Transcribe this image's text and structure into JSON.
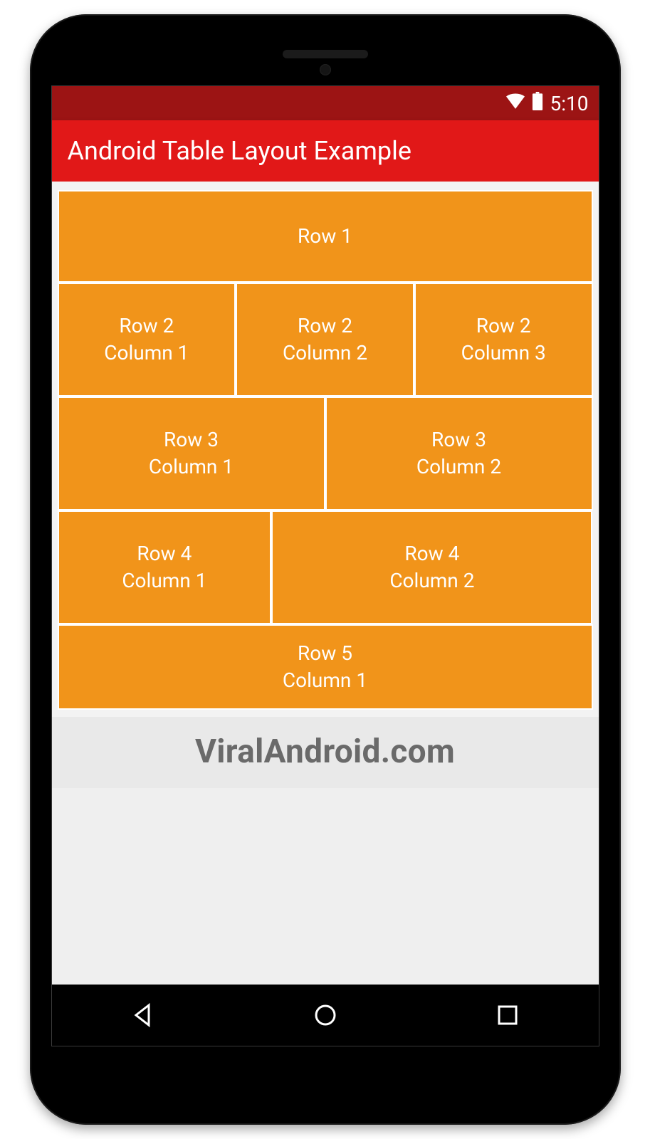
{
  "status": {
    "time": "5:10"
  },
  "appbar": {
    "title": "Android Table Layout Example"
  },
  "table": {
    "row1": {
      "c1": "Row 1"
    },
    "row2": {
      "c1": "Row 2\nColumn 1",
      "c2": "Row 2\nColumn 2",
      "c3": "Row 2\nColumn 3"
    },
    "row3": {
      "c1": "Row 3\nColumn 1",
      "c2": "Row 3\nColumn 2"
    },
    "row4": {
      "c1": "Row 4\nColumn 1",
      "c2": "Row 4\nColumn 2"
    },
    "row5": {
      "c1": "Row 5\nColumn 1"
    }
  },
  "brand": {
    "text": "ViralAndroid.com"
  }
}
